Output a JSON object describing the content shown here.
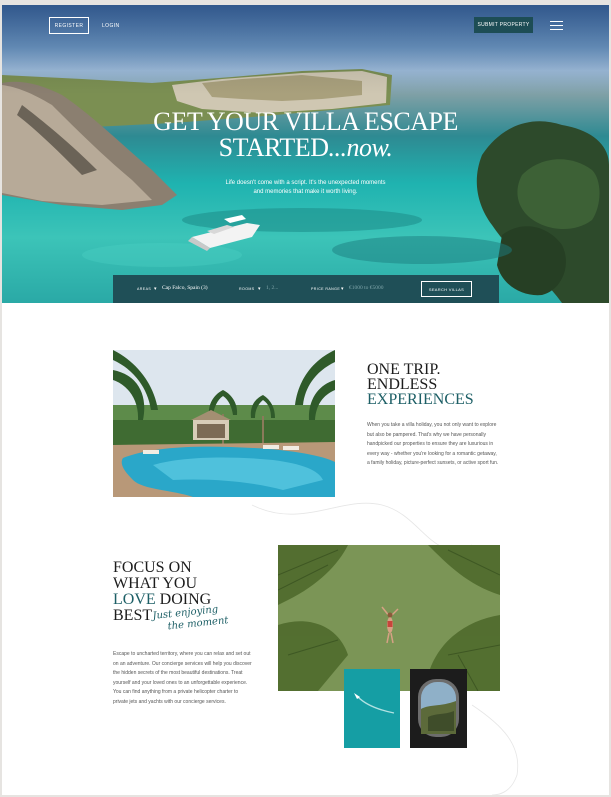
{
  "header": {
    "register_label": "REGISTER",
    "login_label": "LOGIN",
    "submit_label": "SUBMIT PROPERTY",
    "menu_icon": "hamburger-menu-icon"
  },
  "hero": {
    "title_line1": "GET YOUR VILLA ESCAPE",
    "title_line2": "STARTED",
    "title_italic": "...now.",
    "subtitle_line1": "Life doesn't come with a script. It's the unexpected moments",
    "subtitle_line2": "and memories that make it worth living."
  },
  "search": {
    "areas_label": "AREAS",
    "areas_value": "Cap Falco, Spain (3)",
    "rooms_label": "ROOMS",
    "rooms_placeholder": "1, 2...",
    "price_label": "PRICE RANGE",
    "price_placeholder": "€1000 to €5000",
    "search_label": "SEARCH VILLAS",
    "dropdown_icon": "chevron-down-icon"
  },
  "section1": {
    "title_line1": "ONE TRIP.",
    "title_line2": "ENDLESS",
    "title_line3": "EXPERIENCES",
    "body": "When you take a villa holiday, you not only want to explore but also be pampered. That's why we have personally handpicked our properties to ensure they are luxurious in every way - whether you're looking for a romantic getaway, a family holiday, picture-perfect sunsets, or active sport fun."
  },
  "section2": {
    "title_line1": "FOCUS ON",
    "title_line2": "WHAT YOU",
    "title_accent": "LOVE",
    "title_line3_rest": " DOING",
    "title_line4": "BEST",
    "script_line1": "Just enjoying",
    "script_line2": "the moment",
    "body": "Escape to uncharted territory, where you can relax and set out on an adventure.  Our concierge services will help you discover the hidden secrets of the most beautiful destinations. Treat yourself and your loved ones to an unforgettable experience. You can find anything from a private helicopter charter to private jets and yachts with our concierge services."
  },
  "colors": {
    "brand_teal": "#1d4d55",
    "accent_teal": "#1d5f66",
    "sea": "#2ab3ae"
  }
}
